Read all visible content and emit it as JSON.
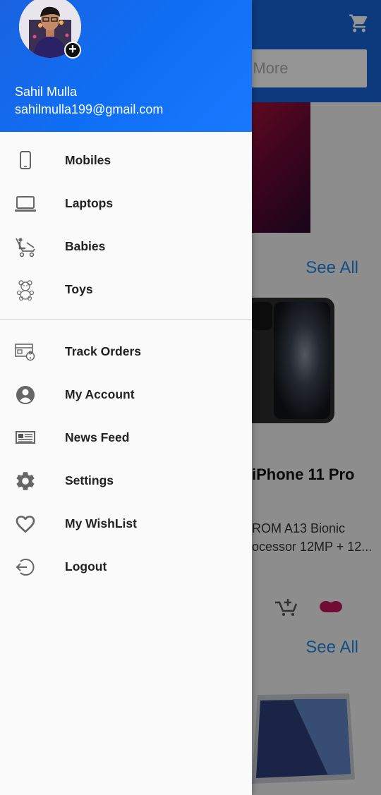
{
  "user": {
    "name": "Sahil Mulla",
    "email": "sahilmulla199@gmail.com",
    "add_photo_glyph": "+"
  },
  "menu": {
    "categories": [
      {
        "label": "Mobiles",
        "icon": "mobile-icon"
      },
      {
        "label": "Laptops",
        "icon": "laptop-icon"
      },
      {
        "label": "Babies",
        "icon": "stroller-icon"
      },
      {
        "label": "Toys",
        "icon": "teddy-bear-icon"
      }
    ],
    "account": [
      {
        "label": "Track Orders",
        "icon": "track-orders-icon"
      },
      {
        "label": "My Account",
        "icon": "account-circle-icon"
      },
      {
        "label": "News Feed",
        "icon": "newspaper-icon"
      },
      {
        "label": "Settings",
        "icon": "gear-icon"
      },
      {
        "label": "My WishList",
        "icon": "heart-icon"
      },
      {
        "label": "Logout",
        "icon": "logout-icon"
      }
    ]
  },
  "background": {
    "search_placeholder": "d More",
    "see_all_1": "See All",
    "see_all_2": "See All",
    "product_title": "iPhone 11 Pro",
    "product_desc_line1": "ROM A13 Bionic",
    "product_desc_line2": "ocessor 12MP + 12..."
  },
  "colors": {
    "header_blue": "#1a6bf0",
    "appbar_blue": "#1565d8",
    "link_blue": "#1e88e5",
    "wishlist_pink": "#c2185b"
  }
}
